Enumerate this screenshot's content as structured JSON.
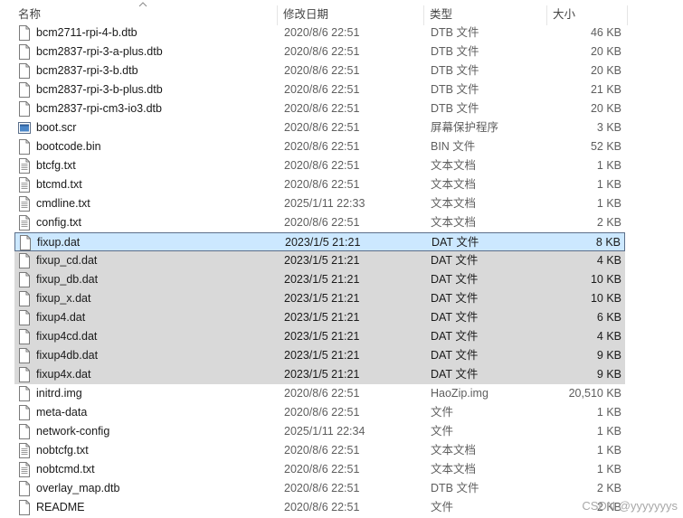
{
  "columns": {
    "name": "名称",
    "date": "修改日期",
    "type": "类型",
    "size": "大小"
  },
  "files": [
    {
      "name": "bcm2711-rpi-4-b.dtb",
      "date": "2020/8/6 22:51",
      "type": "DTB 文件",
      "size": "46 KB",
      "icon": "file-icon"
    },
    {
      "name": "bcm2837-rpi-3-a-plus.dtb",
      "date": "2020/8/6 22:51",
      "type": "DTB 文件",
      "size": "20 KB",
      "icon": "file-icon"
    },
    {
      "name": "bcm2837-rpi-3-b.dtb",
      "date": "2020/8/6 22:51",
      "type": "DTB 文件",
      "size": "20 KB",
      "icon": "file-icon"
    },
    {
      "name": "bcm2837-rpi-3-b-plus.dtb",
      "date": "2020/8/6 22:51",
      "type": "DTB 文件",
      "size": "21 KB",
      "icon": "file-icon"
    },
    {
      "name": "bcm2837-rpi-cm3-io3.dtb",
      "date": "2020/8/6 22:51",
      "type": "DTB 文件",
      "size": "20 KB",
      "icon": "file-icon"
    },
    {
      "name": "boot.scr",
      "date": "2020/8/6 22:51",
      "type": "屏幕保护程序",
      "size": "3 KB",
      "icon": "screensaver-icon"
    },
    {
      "name": "bootcode.bin",
      "date": "2020/8/6 22:51",
      "type": "BIN 文件",
      "size": "52 KB",
      "icon": "file-icon"
    },
    {
      "name": "btcfg.txt",
      "date": "2020/8/6 22:51",
      "type": "文本文档",
      "size": "1 KB",
      "icon": "text-file-icon"
    },
    {
      "name": "btcmd.txt",
      "date": "2020/8/6 22:51",
      "type": "文本文档",
      "size": "1 KB",
      "icon": "text-file-icon"
    },
    {
      "name": "cmdline.txt",
      "date": "2025/1/11 22:33",
      "type": "文本文档",
      "size": "1 KB",
      "icon": "text-file-icon"
    },
    {
      "name": "config.txt",
      "date": "2020/8/6 22:51",
      "type": "文本文档",
      "size": "2 KB",
      "icon": "text-file-icon"
    },
    {
      "name": "fixup.dat",
      "date": "2023/1/5 21:21",
      "type": "DAT 文件",
      "size": "8 KB",
      "icon": "file-icon",
      "state": "focused"
    },
    {
      "name": "fixup_cd.dat",
      "date": "2023/1/5 21:21",
      "type": "DAT 文件",
      "size": "4 KB",
      "icon": "file-icon",
      "state": "selected"
    },
    {
      "name": "fixup_db.dat",
      "date": "2023/1/5 21:21",
      "type": "DAT 文件",
      "size": "10 KB",
      "icon": "file-icon",
      "state": "selected"
    },
    {
      "name": "fixup_x.dat",
      "date": "2023/1/5 21:21",
      "type": "DAT 文件",
      "size": "10 KB",
      "icon": "file-icon",
      "state": "selected"
    },
    {
      "name": "fixup4.dat",
      "date": "2023/1/5 21:21",
      "type": "DAT 文件",
      "size": "6 KB",
      "icon": "file-icon",
      "state": "selected"
    },
    {
      "name": "fixup4cd.dat",
      "date": "2023/1/5 21:21",
      "type": "DAT 文件",
      "size": "4 KB",
      "icon": "file-icon",
      "state": "selected"
    },
    {
      "name": "fixup4db.dat",
      "date": "2023/1/5 21:21",
      "type": "DAT 文件",
      "size": "9 KB",
      "icon": "file-icon",
      "state": "selected"
    },
    {
      "name": "fixup4x.dat",
      "date": "2023/1/5 21:21",
      "type": "DAT 文件",
      "size": "9 KB",
      "icon": "file-icon",
      "state": "selected"
    },
    {
      "name": "initrd.img",
      "date": "2020/8/6 22:51",
      "type": "HaoZip.img",
      "size": "20,510 KB",
      "icon": "file-icon"
    },
    {
      "name": "meta-data",
      "date": "2020/8/6 22:51",
      "type": "文件",
      "size": "1 KB",
      "icon": "file-icon"
    },
    {
      "name": "network-config",
      "date": "2025/1/11 22:34",
      "type": "文件",
      "size": "1 KB",
      "icon": "file-icon"
    },
    {
      "name": "nobtcfg.txt",
      "date": "2020/8/6 22:51",
      "type": "文本文档",
      "size": "1 KB",
      "icon": "text-file-icon"
    },
    {
      "name": "nobtcmd.txt",
      "date": "2020/8/6 22:51",
      "type": "文本文档",
      "size": "1 KB",
      "icon": "text-file-icon"
    },
    {
      "name": "overlay_map.dtb",
      "date": "2020/8/6 22:51",
      "type": "DTB 文件",
      "size": "2 KB",
      "icon": "file-icon"
    },
    {
      "name": "README",
      "date": "2020/8/6 22:51",
      "type": "文件",
      "size": "2 KB",
      "icon": "file-icon"
    }
  ],
  "watermark": "CSDN @yyyyyyys",
  "colors": {
    "selected": "#d9d9d9",
    "focused": "#cce8ff",
    "focusBorder": "#5b6f8a",
    "header": "#444444"
  }
}
